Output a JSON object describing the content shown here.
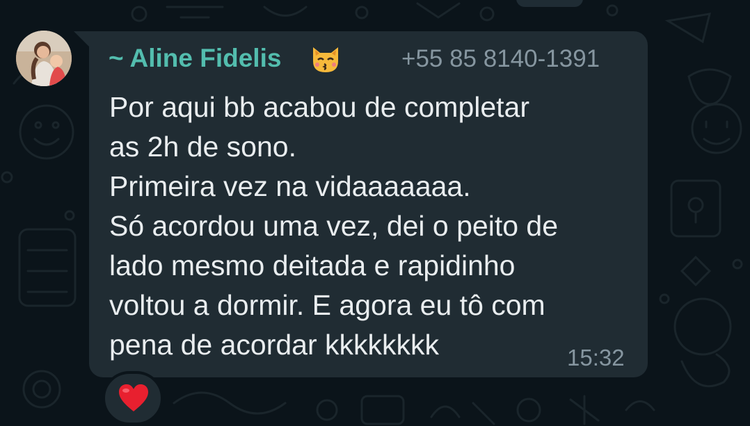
{
  "message": {
    "sender_name": "~ Aline Fidelis",
    "sender_emoji": "kissing-cat-emoji",
    "sender_phone": "+55 85 8140-1391",
    "lines": [
      "Por aqui bb acabou de completar",
      "as 2h de sono.",
      "Primeira vez na vidaaaaaaa.",
      "Só acordou uma vez, dei o peito de",
      "lado mesmo deitada e rapidinho",
      "voltou a dormir. E agora eu tô com",
      "pena de acordar kkkkkkkk"
    ],
    "time": "15:32",
    "reaction": "red-heart-emoji"
  },
  "colors": {
    "background": "#0b141a",
    "bubble": "#202c33",
    "sender_name": "#53bdae",
    "text": "#e9edef",
    "meta": "#8696a0",
    "reaction_heart": "#e8202f"
  }
}
